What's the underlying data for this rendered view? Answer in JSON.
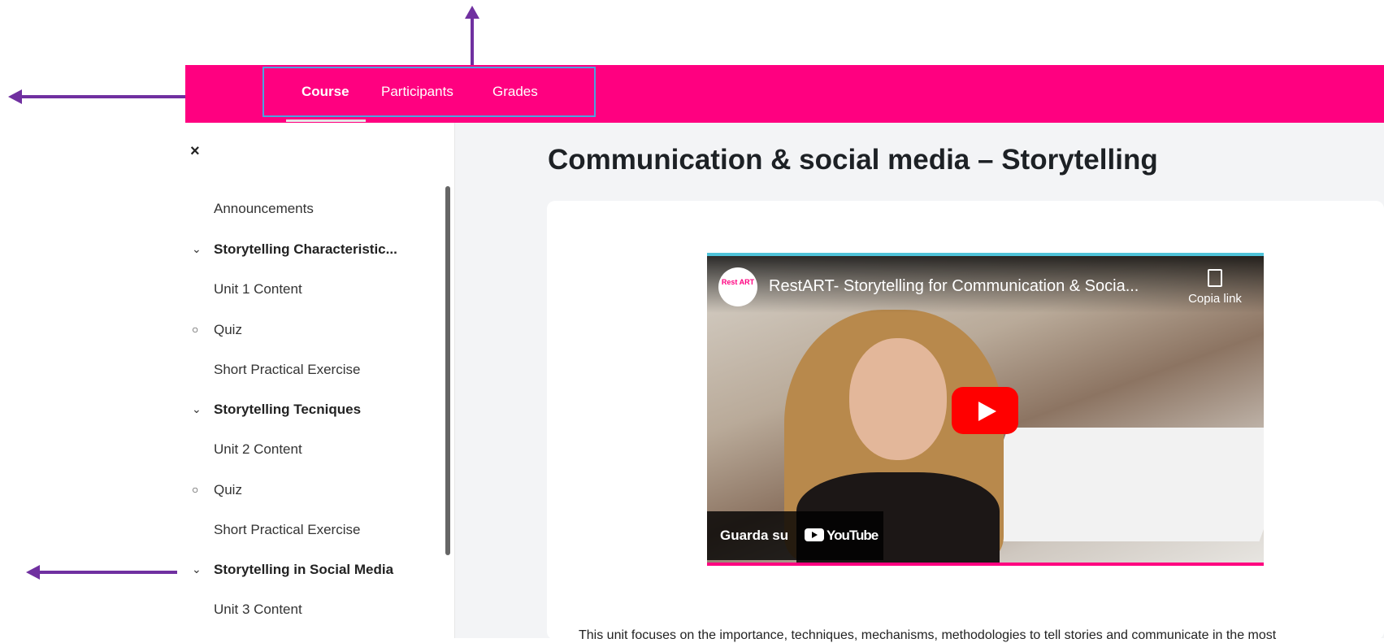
{
  "nav": {
    "items": [
      {
        "label": "Course",
        "active": true
      },
      {
        "label": "Participants",
        "active": false
      },
      {
        "label": "Grades",
        "active": false
      }
    ]
  },
  "sidebar": {
    "close_icon": "×",
    "items": [
      {
        "label": "Announcements",
        "prefix": "",
        "type": "link"
      },
      {
        "label": "Storytelling Characteristic...",
        "prefix": "⌄",
        "type": "section"
      },
      {
        "label": "Unit 1 Content",
        "prefix": "",
        "type": "link"
      },
      {
        "label": "Quiz",
        "prefix": "○",
        "type": "link"
      },
      {
        "label": "Short Practical Exercise",
        "prefix": "",
        "type": "link"
      },
      {
        "label": "Storytelling Tecniques",
        "prefix": "⌄",
        "type": "section"
      },
      {
        "label": "Unit 2 Content",
        "prefix": "",
        "type": "link"
      },
      {
        "label": "Quiz",
        "prefix": "○",
        "type": "link"
      },
      {
        "label": "Short Practical Exercise",
        "prefix": "",
        "type": "link"
      },
      {
        "label": "Storytelling in Social Media",
        "prefix": "⌄",
        "type": "section"
      },
      {
        "label": "Unit 3 Content",
        "prefix": "",
        "type": "link"
      }
    ]
  },
  "main": {
    "title": "Communication & social media – Storytelling",
    "video": {
      "channel_logo_text": "Rest ART",
      "title": "RestART- Storytelling for Communication & Socia...",
      "copy_link": "Copia link",
      "watch_on": "Guarda su",
      "youtube": "YouTube"
    },
    "description": "This unit focuses on the importance, techniques, mechanisms, methodologies to tell stories and communicate in the most"
  },
  "colors": {
    "navbar": "#ff0080",
    "annotation": "#7030a0",
    "highlight": "#4aa3df"
  }
}
